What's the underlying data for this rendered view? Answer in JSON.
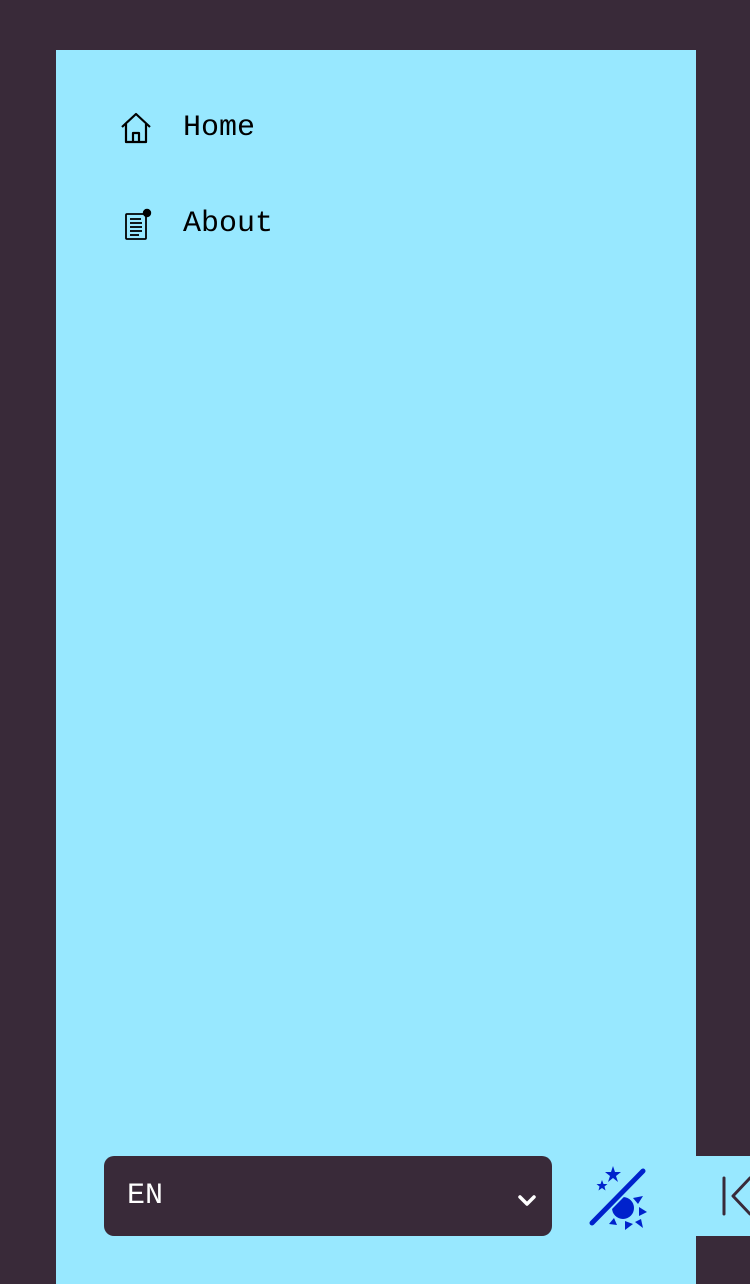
{
  "nav": {
    "items": [
      {
        "label": "Home",
        "icon": "home-icon"
      },
      {
        "label": "About",
        "icon": "document-notification-icon"
      }
    ]
  },
  "footer": {
    "language": {
      "selected": "EN"
    },
    "theme_toggle": {
      "icon": "theme-toggle-moon-sun-icon"
    },
    "collapse": {
      "icon": "collapse-left-icon"
    }
  },
  "colors": {
    "background": "#392a39",
    "sidebar": "#98e8ff",
    "accent": "#0022cc",
    "text": "#000000"
  }
}
